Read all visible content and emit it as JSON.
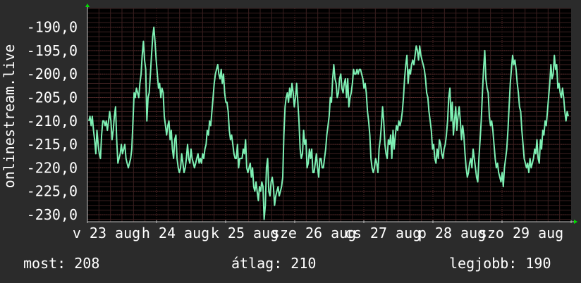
{
  "chart_data": {
    "type": "line",
    "ylabel": "onlinestream.live",
    "y_ticks": [
      "-190,0",
      "-195,0",
      "-200,0",
      "-205,0",
      "-210,0",
      "-215,0",
      "-220,0",
      "-225,0",
      "-230,0"
    ],
    "x_ticks": [
      "v 23 aug",
      "h 24 aug",
      "k 25 aug",
      "sze 26 aug",
      "cs 27 aug",
      "p 28 aug",
      "szo 29 aug"
    ],
    "ylim": [
      -231.5,
      -186.0
    ],
    "grid": true,
    "colors": {
      "background": "#2b2b2b",
      "plot": "#000000",
      "line": "#7ef0b4",
      "grid": "#5a2a2a",
      "axis": "#c0c0c0",
      "arrow": "#00e000"
    },
    "series": [
      {
        "values": [
          -210,
          -209,
          -211,
          -209,
          -212,
          -214,
          -217,
          -212,
          -215,
          -217,
          -218,
          -213,
          -210,
          -210,
          -211,
          -210,
          -212,
          -210,
          -208,
          -210,
          -214,
          -212,
          -209,
          -207,
          -214,
          -219,
          -218,
          -217,
          -215,
          -217,
          -216,
          -215,
          -218,
          -219,
          -220,
          -219,
          -218,
          -216,
          -210,
          -204,
          -205,
          -203,
          -204,
          -205,
          -202,
          -200,
          -196,
          -193,
          -197,
          -199,
          -210,
          -205,
          -204,
          -200,
          -196,
          -192,
          -190,
          -193,
          -197,
          -200,
          -203,
          -202,
          -205,
          -203,
          -204,
          -209,
          -211,
          -213,
          -211,
          -210,
          -214,
          -212,
          -216,
          -218,
          -214,
          -213,
          -218,
          -220,
          -221,
          -220,
          -217,
          -219,
          -221,
          -220,
          -218,
          -215,
          -218,
          -219,
          -216,
          -218,
          -219,
          -220,
          -219,
          -218,
          -217,
          -219,
          -218,
          -219,
          -217,
          -218,
          -216,
          -215,
          -212,
          -213,
          -210,
          -211,
          -208,
          -205,
          -202,
          -200,
          -199,
          -198,
          -200,
          -201,
          -199,
          -202,
          -200,
          -204,
          -206,
          -206,
          -208,
          -212,
          -214,
          -213,
          -215,
          -217,
          -218,
          -218,
          -215,
          -220,
          -218,
          -218,
          -218,
          -216,
          -217,
          -214,
          -220,
          -221,
          -220,
          -219,
          -222,
          -220,
          -224,
          -225,
          -223,
          -225,
          -227,
          -224,
          -225,
          -223,
          -224,
          -231,
          -228,
          -220,
          -218,
          -225,
          -226,
          -223,
          -222,
          -224,
          -228,
          -226,
          -225,
          -224,
          -226,
          -225,
          -224,
          -222,
          -213,
          -207,
          -205,
          -204,
          -206,
          -203,
          -205,
          -202,
          -204,
          -207,
          -205,
          -202,
          -206,
          -210,
          -216,
          -218,
          -217,
          -212,
          -215,
          -214,
          -220,
          -219,
          -216,
          -218,
          -216,
          -221,
          -221,
          -219,
          -217,
          -220,
          -222,
          -218,
          -218,
          -220,
          -220,
          -218,
          -216,
          -213,
          -211,
          -209,
          -205,
          -206,
          -201,
          -198,
          -201,
          -202,
          -205,
          -204,
          -201,
          -200,
          -203,
          -204,
          -202,
          -201,
          -205,
          -201,
          -207,
          -205,
          -204,
          -202,
          -199,
          -200,
          -200,
          -199,
          -200,
          -199,
          -199,
          -200,
          -201,
          -203,
          -202,
          -204,
          -208,
          -210,
          -213,
          -218,
          -220,
          -221,
          -220,
          -218,
          -219,
          -221,
          -216,
          -214,
          -211,
          -207,
          -210,
          -215,
          -217,
          -218,
          -214,
          -215,
          -213,
          -218,
          -212,
          -216,
          -213,
          -211,
          -212,
          -210,
          -211,
          -210,
          -208,
          -205,
          -201,
          -198,
          -196,
          -202,
          -199,
          -200,
          -198,
          -197,
          -198,
          -196,
          -194,
          -195,
          -197,
          -194,
          -196,
          -197,
          -198,
          -199,
          -201,
          -204,
          -205,
          -208,
          -210,
          -212,
          -216,
          -215,
          -218,
          -219,
          -216,
          -218,
          -214,
          -215,
          -217,
          -218,
          -216,
          -215,
          -213,
          -210,
          -205,
          -203,
          -210,
          -206,
          -213,
          -210,
          -207,
          -212,
          -209,
          -207,
          -210,
          -214,
          -211,
          -213,
          -217,
          -220,
          -222,
          -221,
          -219,
          -218,
          -220,
          -216,
          -218,
          -220,
          -222,
          -223,
          -218,
          -214,
          -210,
          -204,
          -199,
          -195,
          -201,
          -203,
          -204,
          -209,
          -211,
          -210,
          -212,
          -215,
          -218,
          -220,
          -219,
          -221,
          -222,
          -223,
          -221,
          -224,
          -220,
          -218,
          -216,
          -212,
          -207,
          -202,
          -199,
          -196,
          -198,
          -197,
          -199,
          -202,
          -204,
          -207,
          -208,
          -212,
          -215,
          -218,
          -219,
          -220,
          -219,
          -221,
          -218,
          -220,
          -219,
          -218,
          -216,
          -217,
          -214,
          -218,
          -219,
          -214,
          -216,
          -212,
          -213,
          -210,
          -211,
          -208,
          -205,
          -202,
          -198,
          -201,
          -200,
          -196,
          -199,
          -198,
          -203,
          -202,
          -204,
          -205,
          -203,
          -205,
          -208,
          -210,
          -208,
          -209
        ]
      }
    ]
  },
  "footer": {
    "most": "most: 208",
    "avg": "átlag: 210",
    "best": "legjobb: 190"
  }
}
